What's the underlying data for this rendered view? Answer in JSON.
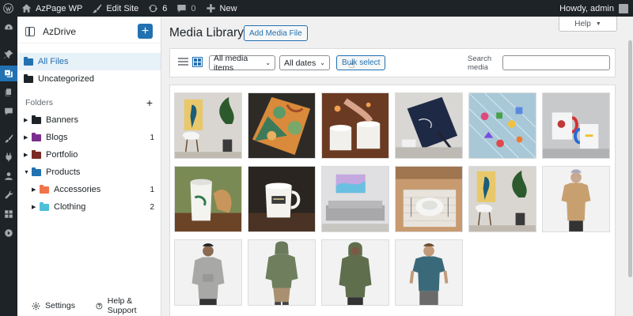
{
  "adminbar": {
    "site_name": "AzPage WP",
    "edit_site": "Edit Site",
    "updates_count": "6",
    "comments_count": "0",
    "new_label": "New",
    "howdy": "Howdy, admin"
  },
  "sidebar": {
    "title": "AzDrive",
    "all_files": "All Files",
    "uncategorized": "Uncategorized",
    "folders_heading": "Folders",
    "folders": [
      {
        "name": "Banners",
        "count": "",
        "color": "#1d2327"
      },
      {
        "name": "Blogs",
        "count": "1",
        "color": "#7b2d8e"
      },
      {
        "name": "Portfolio",
        "count": "",
        "color": "#7a2b26"
      },
      {
        "name": "Products",
        "count": "",
        "color": "#2271b1"
      },
      {
        "name": "Accessories",
        "count": "1",
        "color": "#f0744a"
      },
      {
        "name": "Clothing",
        "count": "2",
        "color": "#4ec0d8"
      }
    ],
    "settings": "Settings",
    "help_support": "Help & Support"
  },
  "main": {
    "help_label": "Help",
    "title": "Media Library",
    "add_media": "Add Media File",
    "filter_type": "All media items",
    "filter_date": "All dates",
    "bulk_select": "Bulk select",
    "search_label": "Search media",
    "search_value": ""
  },
  "media": [
    {
      "icon": "parrot-poster-chair-image"
    },
    {
      "icon": "fabric-pattern-image"
    },
    {
      "icon": "mugs-marshmallow-image"
    },
    {
      "icon": "notebook-pen-image"
    },
    {
      "icon": "stickers-image"
    },
    {
      "icon": "mugs-colored-image"
    },
    {
      "icon": "tumbler-image"
    },
    {
      "icon": "mug-logo-image"
    },
    {
      "icon": "poster-couch-image"
    },
    {
      "icon": "table-setting-image"
    },
    {
      "icon": "parrot-poster-chair-image-2"
    },
    {
      "icon": "tshirt-woman-image"
    },
    {
      "icon": "hoodie-man-grey-image"
    },
    {
      "icon": "hoodie-green-back-image"
    },
    {
      "icon": "hoodie-woman-green-image"
    },
    {
      "icon": "tshirt-man-teal-image"
    }
  ],
  "colors": {
    "accent": "#2271b1",
    "adminbar": "#1d2327"
  }
}
